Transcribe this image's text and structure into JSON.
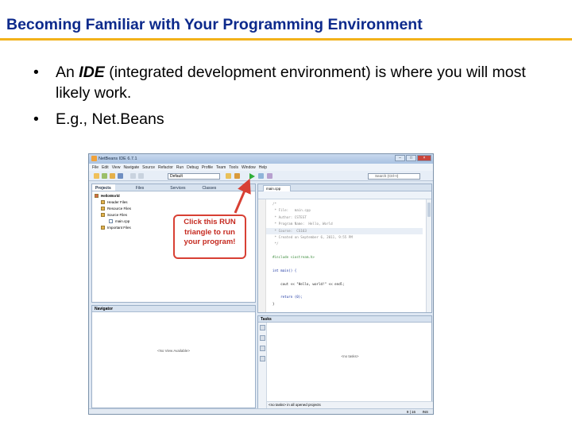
{
  "slide": {
    "title": "Becoming Familiar with Your Programming Environment",
    "bullet_symbol": "•",
    "bullet1": {
      "prefix": "An ",
      "emphasis": "IDE",
      "suffix": " (integrated development environment) is where you will most likely work."
    },
    "bullet2": "E.g., Net.Beans"
  },
  "ide": {
    "window_title": "NetBeans IDE 6.7.1",
    "menu": [
      "File",
      "Edit",
      "View",
      "Navigate",
      "Source",
      "Refactor",
      "Run",
      "Debug",
      "Profile",
      "Team",
      "Tools",
      "Window",
      "Help"
    ],
    "config_combo": "Default",
    "search_placeholder": "Search (Ctrl+I)",
    "panel_tabs": [
      "Projects",
      "Files",
      "Services",
      "Classes"
    ],
    "project_tree": [
      "HelloWorld",
      "Header Files",
      "Resource Files",
      "Source Files",
      "main.cpp",
      "Important Files"
    ],
    "navigator": {
      "title": "Navigator",
      "empty": "<No View Available>"
    },
    "editor_tab": "main.cpp",
    "code": [
      "/*",
      " * File:   main.cpp",
      " * Author: CSTEST",
      " * Program Name:  Hello, World",
      " * Course:  CS163",
      " * Created on September 6, 2011, 9:55 PM",
      " */",
      "",
      "#include <iostream.h>",
      "",
      "int main() {",
      "",
      "    cout << \"Hello, world!\" << endl;",
      "",
      "    return (0);",
      "}"
    ],
    "tasks": {
      "title": "Tasks",
      "empty": "<no tasks>",
      "filter": "<no tasks> in all opened projects"
    },
    "status": {
      "position": "9 | 16",
      "mode": "INS"
    }
  },
  "callout": {
    "lines": [
      "Click this RUN",
      "triangle to run",
      "your program!"
    ]
  },
  "colors": {
    "title": "#0d2a8c",
    "rule": "#f2b21b",
    "callout": "#d84034",
    "run_triangle": "#2fae38"
  }
}
